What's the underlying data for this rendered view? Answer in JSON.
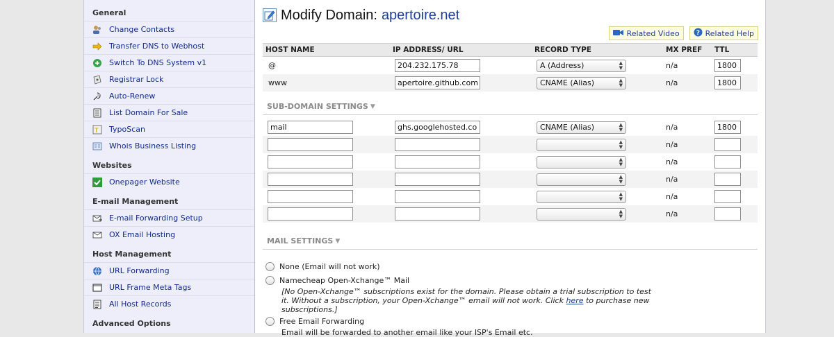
{
  "sidebar": {
    "sections": [
      {
        "title": "General",
        "items": [
          {
            "label": "Change Contacts",
            "icon": "contacts-icon"
          },
          {
            "label": "Transfer DNS to Webhost",
            "icon": "arrow-right-icon"
          },
          {
            "label": "Switch To DNS System v1",
            "icon": "switch-icon"
          },
          {
            "label": "Registrar Lock",
            "icon": "lock-icon"
          },
          {
            "label": "Auto-Renew",
            "icon": "renew-icon"
          },
          {
            "label": "List Domain For Sale",
            "icon": "list-icon"
          },
          {
            "label": "TypoScan",
            "icon": "typoscan-icon"
          },
          {
            "label": "Whois Business Listing",
            "icon": "whois-icon"
          }
        ]
      },
      {
        "title": "Websites",
        "items": [
          {
            "label": "Onepager Website",
            "icon": "checkmark-icon"
          }
        ]
      },
      {
        "title": "E-mail Management",
        "items": [
          {
            "label": "E-mail Forwarding Setup",
            "icon": "email-forward-icon"
          },
          {
            "label": "OX Email Hosting",
            "icon": "envelope-icon"
          }
        ]
      },
      {
        "title": "Host Management",
        "items": [
          {
            "label": "URL Forwarding",
            "icon": "globe-icon"
          },
          {
            "label": "URL Frame Meta Tags",
            "icon": "frame-icon"
          },
          {
            "label": "All Host Records",
            "icon": "records-icon"
          }
        ]
      },
      {
        "title": "Advanced Options",
        "items": []
      }
    ]
  },
  "main": {
    "title": "Modify Domain:",
    "domain": "apertoire.net",
    "related_video": "Related Video",
    "related_help": "Related Help",
    "columns": {
      "host": "HOST NAME",
      "ip": "IP ADDRESS/ URL",
      "type": "RECORD TYPE",
      "mx": "MX PREF",
      "ttl": "TTL"
    },
    "records": [
      {
        "host": "@",
        "ip": "204.232.175.78",
        "type": "A (Address)",
        "mx": "n/a",
        "ttl": "1800"
      },
      {
        "host": "www",
        "ip": "apertoire.github.com.",
        "type": "CNAME (Alias)",
        "mx": "n/a",
        "ttl": "1800"
      }
    ],
    "subdomain_heading": "SUB-DOMAIN SETTINGS",
    "subdomains": [
      {
        "host": "mail",
        "ip": "ghs.googlehosted.com",
        "type": "CNAME (Alias)",
        "mx": "n/a",
        "ttl": "1800"
      },
      {
        "host": "",
        "ip": "",
        "type": "",
        "mx": "n/a",
        "ttl": ""
      },
      {
        "host": "",
        "ip": "",
        "type": "",
        "mx": "n/a",
        "ttl": ""
      },
      {
        "host": "",
        "ip": "",
        "type": "",
        "mx": "n/a",
        "ttl": ""
      },
      {
        "host": "",
        "ip": "",
        "type": "",
        "mx": "n/a",
        "ttl": ""
      },
      {
        "host": "",
        "ip": "",
        "type": "",
        "mx": "n/a",
        "ttl": ""
      }
    ],
    "mail_heading": "MAIL SETTINGS",
    "mail": {
      "option_none": "None (Email will not work)",
      "option_ox": "Namecheap Open-Xchange™ Mail",
      "ox_note_1": "[No Open-Xchange™ subscriptions exist for the domain. Please obtain a trial subscription to test it. Without a subscription, your Open-Xchange™ email will not work. Click",
      "ox_note_link": "here",
      "ox_note_2": "to purchase new subscriptions.]",
      "option_forwarding": "Free Email Forwarding",
      "forwarding_note": "Email will be forwarded to another email like your ISP's Email etc."
    }
  }
}
